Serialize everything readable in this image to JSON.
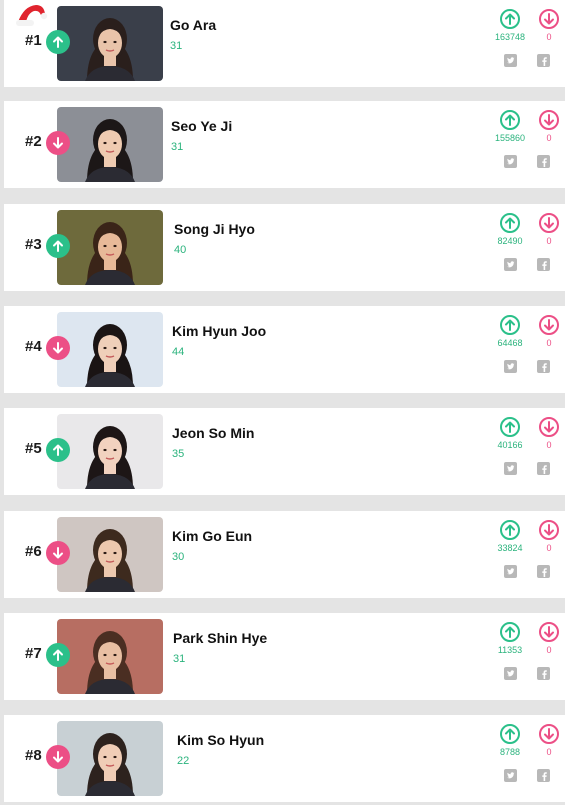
{
  "ranking": {
    "items": [
      {
        "rank": "#1",
        "name": "Go Ara",
        "score": "31",
        "trend": "up",
        "upvotes": "163748",
        "downvotes": "0"
      },
      {
        "rank": "#2",
        "name": "Seo Ye Ji",
        "score": "31",
        "trend": "down",
        "upvotes": "155860",
        "downvotes": "0"
      },
      {
        "rank": "#3",
        "name": "Song Ji Hyo",
        "score": "40",
        "trend": "up",
        "upvotes": "82490",
        "downvotes": "0"
      },
      {
        "rank": "#4",
        "name": "Kim Hyun Joo",
        "score": "44",
        "trend": "down",
        "upvotes": "64468",
        "downvotes": "0"
      },
      {
        "rank": "#5",
        "name": "Jeon So Min",
        "score": "35",
        "trend": "up",
        "upvotes": "40166",
        "downvotes": "0"
      },
      {
        "rank": "#6",
        "name": "Kim Go Eun",
        "score": "30",
        "trend": "down",
        "upvotes": "33824",
        "downvotes": "0"
      },
      {
        "rank": "#7",
        "name": "Park Shin Hye",
        "score": "31",
        "trend": "up",
        "upvotes": "11353",
        "downvotes": "0"
      },
      {
        "rank": "#8",
        "name": "Kim So Hyun",
        "score": "22",
        "trend": "down",
        "upvotes": "8788",
        "downvotes": "0"
      }
    ]
  },
  "colors": {
    "up": "#2bc08a",
    "down": "#ec4f86",
    "score": "#2bb37d",
    "row_bg": "#ffffff",
    "page_bg": "#e4e4e4"
  },
  "icons": {
    "trend_up": "arrow-up-icon",
    "trend_down": "arrow-down-icon",
    "vote_up": "upvote-icon",
    "vote_down": "downvote-icon",
    "share_twitter": "twitter-icon",
    "share_facebook": "facebook-icon",
    "decoration": "santa-hat-icon"
  }
}
